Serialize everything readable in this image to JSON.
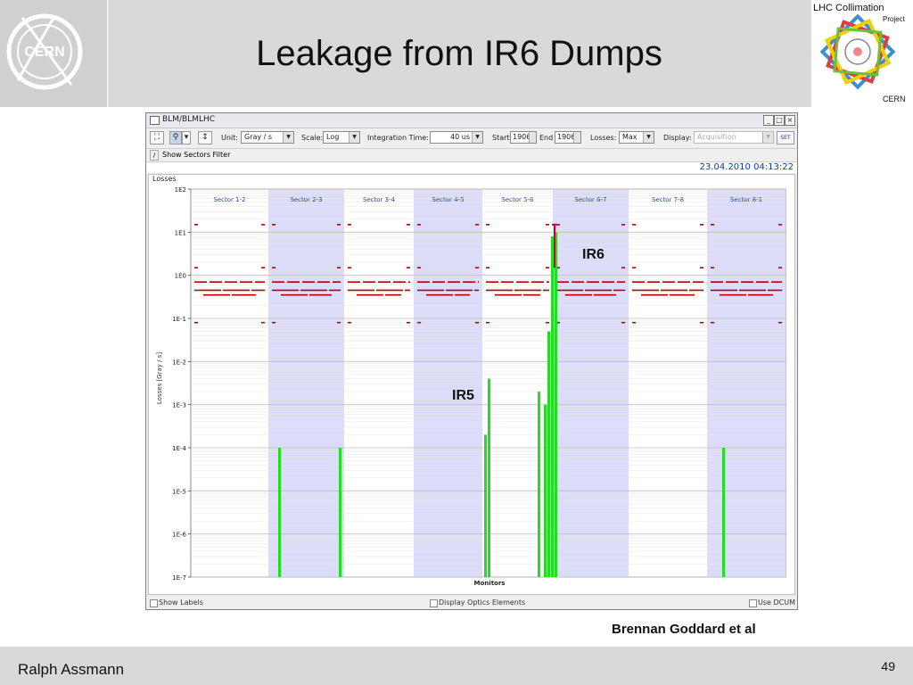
{
  "slide": {
    "title": "Leakage from IR6 Dumps",
    "credit": "Brennan Goddard et al",
    "author": "Ralph Assmann",
    "page_number": "49",
    "logo_text": "CERN",
    "project_logo": {
      "line1": "LHC Collimation",
      "line2": "Project",
      "line3": "CERN"
    }
  },
  "window": {
    "title": "BLM/BLMLHC",
    "toolbar": {
      "unit_label": "Unit:",
      "unit_value": "Gray / s",
      "scale_label": "Scale:",
      "scale_value": "Log",
      "integration_label": "Integration Time:",
      "integration_value": "40 us",
      "start_label": "Start",
      "start_value": "1906",
      "end_label": "End",
      "end_value": "1906",
      "losses_label": "Losses:",
      "losses_value": "Max",
      "display_label": "Display:",
      "display_value": "Acquisition",
      "set_button": "SET"
    },
    "filter_label": "Show Sectors Filter",
    "timestamp": "23.04.2010 04:13:22",
    "panel_caption": "Losses",
    "bottom": {
      "show_labels": "Show Labels",
      "display_optics": "Display Optics Elements",
      "use_dcum": "Use DCUM"
    }
  },
  "annotations": {
    "ir6": "IR6",
    "ir5": "IR5"
  },
  "colors": {
    "sector_shade": "#dcdcfa",
    "loss_bar": "#22dd22",
    "threshold": "#b40000",
    "sector_label": "#1a3bb8"
  },
  "chart_data": {
    "type": "bar",
    "title": "",
    "xlabel": "Monitors",
    "ylabel": "Losses [Gray / s]",
    "yscale": "log",
    "ylim": [
      1e-07,
      100
    ],
    "y_ticks": [
      "1E2",
      "1E1",
      "1E0",
      "1E-1",
      "1E-2",
      "1E-3",
      "1E-4",
      "1E-5",
      "1E-6",
      "1E-7"
    ],
    "sectors": [
      {
        "name": "Sector 1-2",
        "shaded": false
      },
      {
        "name": "Sector 2-3",
        "shaded": true
      },
      {
        "name": "Sector 3-4",
        "shaded": false
      },
      {
        "name": "Sector 4-5",
        "shaded": true
      },
      {
        "name": "Sector 5-6",
        "shaded": false
      },
      {
        "name": "Sector 6-7",
        "shaded": true
      },
      {
        "name": "Sector 7-8",
        "shaded": false
      },
      {
        "name": "Sector 8-1",
        "shaded": true
      }
    ],
    "loss_bars": [
      {
        "sector": "Sector 2-3",
        "value": 0.0001
      },
      {
        "sector": "Sector 2-3",
        "value": 0.0001
      },
      {
        "sector": "Sector 4-5",
        "value": 0.0002
      },
      {
        "sector": "Sector 4-5",
        "value": 0.004
      },
      {
        "sector": "Sector 5-6",
        "value": 0.002
      },
      {
        "sector": "Sector 5-6",
        "value": 0.001
      },
      {
        "sector": "Sector 5-6",
        "value": 0.05
      },
      {
        "sector": "Sector 5-6",
        "value": 8
      },
      {
        "sector": "Sector 5-6",
        "value": 10
      },
      {
        "sector": "Sector 8-1",
        "value": 0.0001
      }
    ],
    "thresholds": {
      "typical_levels": [
        0.7,
        0.45,
        0.35,
        0.08,
        1.5,
        15
      ]
    }
  }
}
